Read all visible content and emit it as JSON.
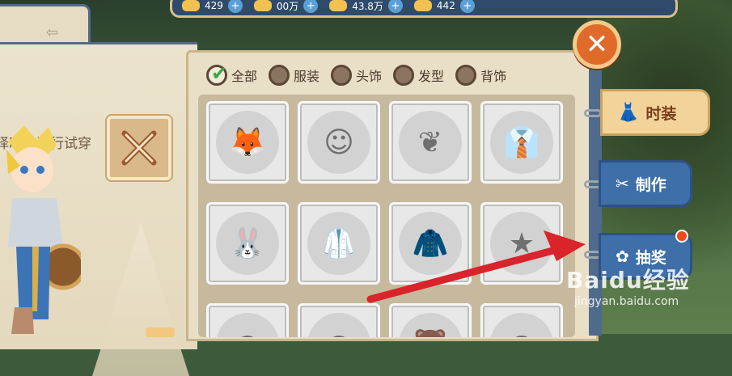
{
  "topbar": {
    "currencies": [
      {
        "value": "429",
        "icon": "gold-coin-icon"
      },
      {
        "value": "00万",
        "icon": "wing-coin-icon"
      },
      {
        "value": "43.8万",
        "icon": "gold-bar-icon"
      },
      {
        "value": "442",
        "icon": "crystal-icon"
      }
    ]
  },
  "left": {
    "tip_text": "择时装进行试穿"
  },
  "filters": [
    {
      "label": "全部",
      "checked": true
    },
    {
      "label": "服装",
      "checked": false
    },
    {
      "label": "头饰",
      "checked": false
    },
    {
      "label": "发型",
      "checked": false
    },
    {
      "label": "背饰",
      "checked": false
    }
  ],
  "items": [
    {
      "icon": "fox-pet-icon",
      "glyph": "🦊"
    },
    {
      "icon": "paper-bag-mask-icon",
      "glyph": "☺"
    },
    {
      "icon": "wings-icon",
      "glyph": "❦"
    },
    {
      "icon": "suit-outfit-icon",
      "glyph": "👔"
    },
    {
      "icon": "bunny-hat-icon",
      "glyph": "🐰"
    },
    {
      "icon": "lab-coat-icon",
      "glyph": "🥼"
    },
    {
      "icon": "formal-suit-icon",
      "glyph": "🧥"
    },
    {
      "icon": "star-shirt-icon",
      "glyph": "★"
    },
    {
      "icon": "hair-dark-icon",
      "glyph": "●"
    },
    {
      "icon": "hair-light-icon",
      "glyph": "◐"
    },
    {
      "icon": "bear-hat-icon",
      "glyph": "🐻"
    },
    {
      "icon": "hair-mid-icon",
      "glyph": "◑"
    }
  ],
  "tabs": {
    "fashion": "时装",
    "craft": "制作",
    "lottery": "抽奖"
  },
  "close_glyph": "✕",
  "watermark": {
    "brand": "Baidu经验",
    "url": "jingyan.baidu.com"
  },
  "colors": {
    "accent_red": "#d8242a",
    "tab_blue": "#3e6fa8",
    "tab_active": "#f2d49a"
  }
}
